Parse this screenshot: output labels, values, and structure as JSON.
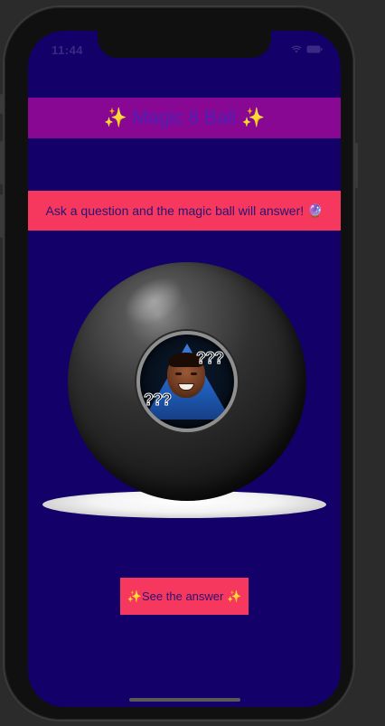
{
  "status_bar": {
    "time": "11:44"
  },
  "header": {
    "title": "✨ Magic 8 Ball ✨"
  },
  "prompt": {
    "text": "Ask a question and the magic ball will answer! 🔮"
  },
  "ball": {
    "overlay_left": "???",
    "overlay_right": "???"
  },
  "answer_button": {
    "label": "✨See the answer ✨"
  },
  "colors": {
    "background": "#130068",
    "header": "#880893",
    "accent": "#f7385e",
    "text_dark": "#271474",
    "title_text": "#4d1fb5"
  }
}
